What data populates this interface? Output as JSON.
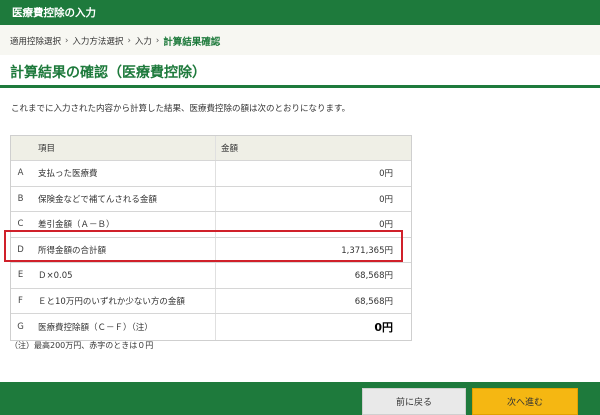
{
  "window": {
    "title": "医療費控除の入力"
  },
  "breadcrumb": {
    "items": [
      "適用控除選択",
      "入力方法選択",
      "入力",
      "計算結果確認"
    ],
    "separator": "›"
  },
  "page": {
    "title": "計算結果の確認（医療費控除）",
    "intro": "これまでに入力された内容から計算した結果、医療費控除の額は次のとおりになります。"
  },
  "table": {
    "headers": {
      "item": "項目",
      "amount": "金額"
    },
    "rows": [
      {
        "letter": "A",
        "item": "支払った医療費",
        "amount": "0円"
      },
      {
        "letter": "B",
        "item": "保険金などで補てんされる金額",
        "amount": "0円"
      },
      {
        "letter": "C",
        "item": "差引金額（Ａ－Ｂ）",
        "amount": "0円"
      },
      {
        "letter": "D",
        "item": "所得金額の合計額",
        "amount": "1,371,365円"
      },
      {
        "letter": "E",
        "item": "Ｄ×0.05",
        "amount": "68,568円"
      },
      {
        "letter": "F",
        "item": "Ｅと10万円のいずれか少ない方の金額",
        "amount": "68,568円"
      },
      {
        "letter": "G",
        "item": "医療費控除額（Ｃ－Ｆ）（注）",
        "amount": "0円"
      }
    ]
  },
  "footnote": "（注）最高200万円、赤字のときは０円",
  "buttons": {
    "back": "前に戻る",
    "next": "次へ進む"
  },
  "colors": {
    "brand": "#1e7a3c",
    "highlight": "#d0202a",
    "next_button": "#f5b712"
  }
}
